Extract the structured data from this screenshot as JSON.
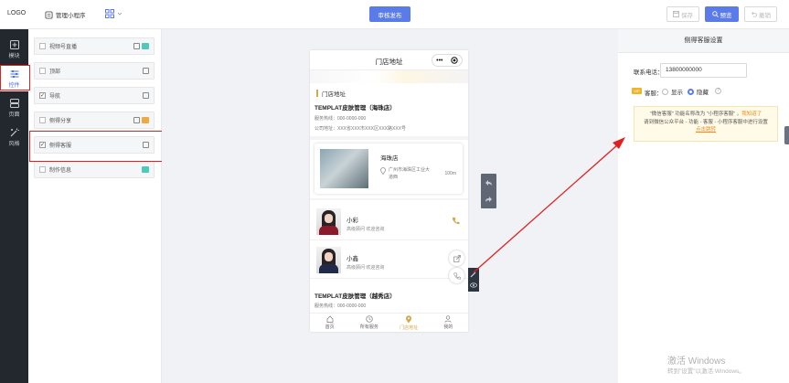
{
  "topbar": {
    "logo": "LOGO",
    "manage_label": "管理小程序",
    "publish_label": "审核发布",
    "save_label": "保存",
    "preview_label": "预览",
    "undo_label": "撤销"
  },
  "leftnav": [
    {
      "label": "模块",
      "icon": "plus-square-icon"
    },
    {
      "label": "控件",
      "icon": "sliders-icon"
    },
    {
      "label": "页面",
      "icon": "pages-icon"
    },
    {
      "label": "风格",
      "icon": "magic-wand-icon"
    }
  ],
  "components": [
    {
      "label": "视频号直播",
      "checked": false,
      "tag": "teal"
    },
    {
      "label": "顶部",
      "checked": false,
      "tag": ""
    },
    {
      "label": "导航",
      "checked": true,
      "tag": ""
    },
    {
      "label": "侧得分享",
      "checked": false,
      "tag": "orange"
    },
    {
      "label": "侧得客服",
      "checked": true,
      "tag": ""
    },
    {
      "label": "制作信息",
      "checked": false,
      "tag": "teal"
    }
  ],
  "phone": {
    "title": "门店地址",
    "capsule_dots": "•••",
    "section_title": "门店地址",
    "store1": {
      "name": "TEMPLAT皮肤管理（海珠店）",
      "hotline": "服务热线：000-0000-000",
      "address": "公司地址：XXX省XXX市XXX区XXX路XXX号"
    },
    "card": {
      "name": "海珠店",
      "address": "广州市海珠区工业大道西",
      "distance": "100m"
    },
    "persons": [
      {
        "name": "小彩",
        "role": "高级顾问 欢迎咨询"
      },
      {
        "name": "小鑫",
        "role": "高级顾问 欢迎咨询"
      }
    ],
    "store2": {
      "name": "TEMPLAT皮肤管理（越秀店）",
      "hotline": "服务热线：000-0000-000"
    },
    "tabs": [
      {
        "label": "首页",
        "icon": "home-icon"
      },
      {
        "label": "所有服务",
        "icon": "clock-icon"
      },
      {
        "label": "门店地址",
        "icon": "location-icon"
      },
      {
        "label": "我的",
        "icon": "user-icon"
      }
    ]
  },
  "settings": {
    "title": "侧得客服设置",
    "phone_label": "联系电话：",
    "phone_value": "13800000000",
    "kefu_label": "客服：",
    "kefu_badge": "VIP",
    "show_label": "显示",
    "hide_label": "隐藏",
    "selected": "hide",
    "tip_line1a": "\"微信客服\" 功能名称改为 \"小程序客服\" ，",
    "tip_line1b": "我知道了",
    "tip_line2": "请到微信公众平台 - 功能 - 客服 - 小程序客服中进行设置",
    "tip_line3": "点击跳转"
  },
  "watermark": {
    "line1": "激活 Windows",
    "line2": "转到\"设置\"以激活 Windows。"
  },
  "colors": {
    "accent": "#5b7be9",
    "gold": "#d4a94b",
    "highlight_red": "#e02020",
    "sidebar_dark": "#23272e"
  }
}
